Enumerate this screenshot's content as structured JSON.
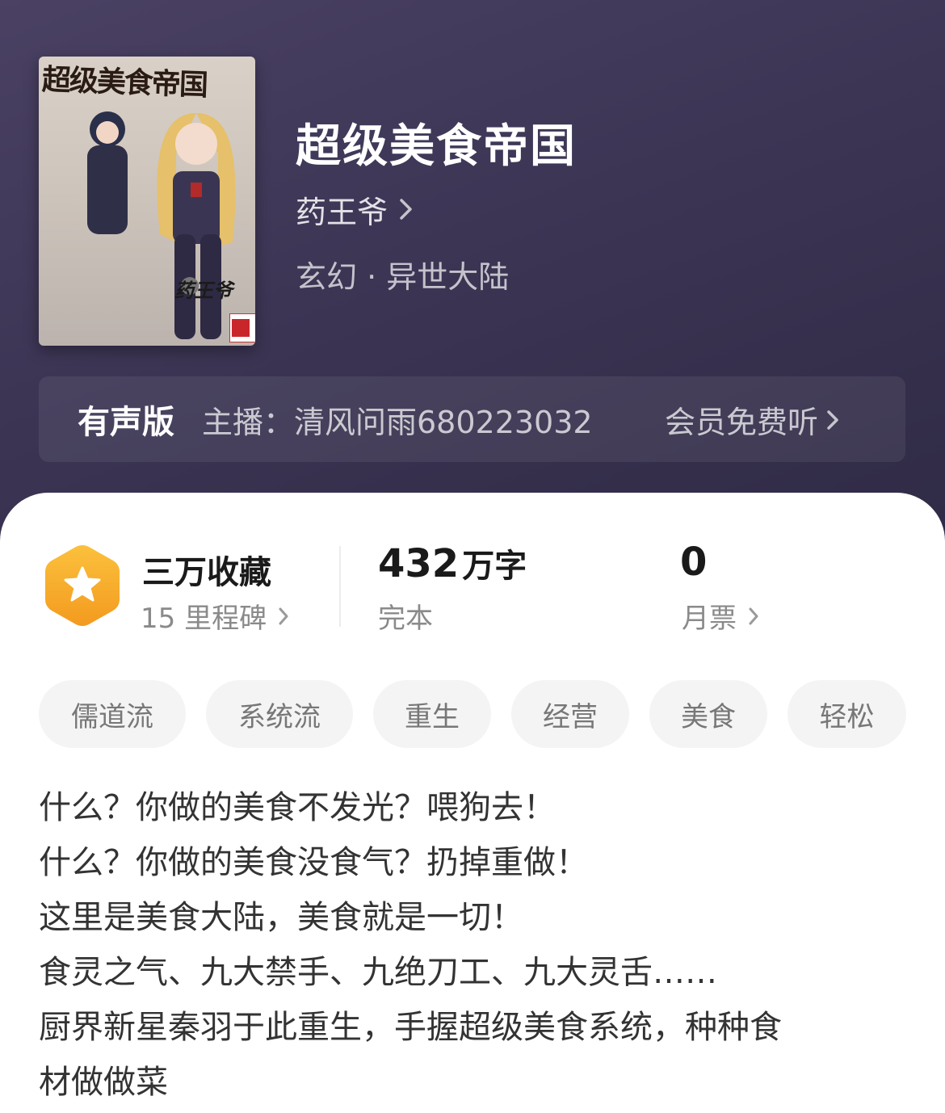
{
  "book": {
    "cover_title": "超级美食帝国",
    "cover_author": "药王爷",
    "title": "超级美食帝国",
    "author": "药王爷",
    "genre": "玄幻 · 异世大陆"
  },
  "audio": {
    "label": "有声版",
    "host": "主播：清风问雨680223032",
    "cta": "会员免费听"
  },
  "stats": {
    "favorites": "三万收藏",
    "milestones": "15 里程碑",
    "word_count_number": "432",
    "word_count_unit": "万字",
    "status": "完本",
    "monthly_votes": "0",
    "monthly_votes_label": "月票"
  },
  "tags": [
    "儒道流",
    "系统流",
    "重生",
    "经营",
    "美食",
    "轻松"
  ],
  "description": [
    "什么？你做的美食不发光？喂狗去！",
    "什么？你做的美食没食气？扔掉重做！",
    "这里是美食大陆，美食就是一切！",
    "食灵之气、九大禁手、九绝刀工、九大灵舌……",
    "厨界新星秦羽于此重生，手握超级美食系统，种种食",
    "材做做菜"
  ],
  "colors": {
    "header_bg": "#3c3554",
    "badge_orange": "#f5a623",
    "card_bg": "#ffffff",
    "tag_bg": "#f4f4f4"
  },
  "icons": {
    "author_chevron": "chevron-right-icon",
    "audio_chevron": "chevron-right-icon",
    "milestone_chevron": "chevron-right-icon",
    "votes_chevron": "chevron-right-icon",
    "badge": "star-hexagon-icon"
  }
}
